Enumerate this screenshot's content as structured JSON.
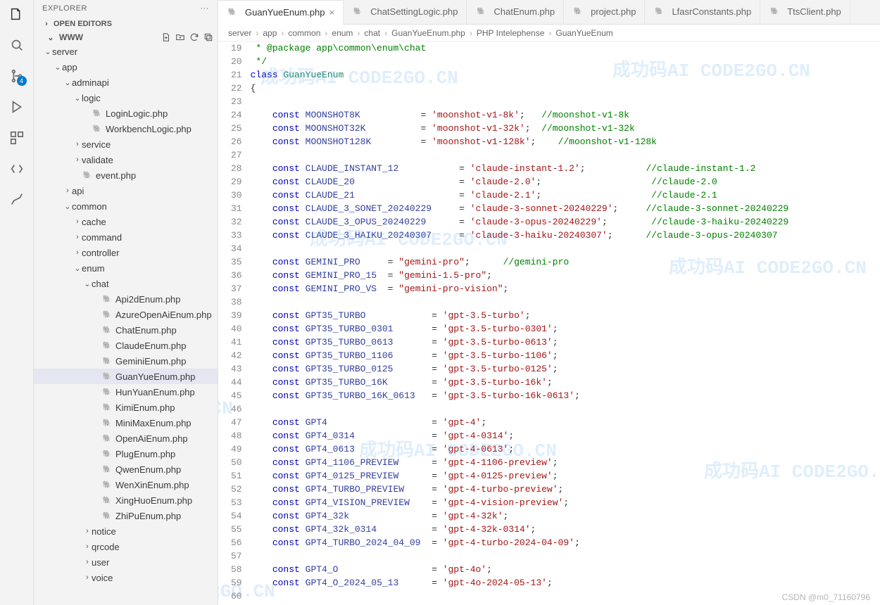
{
  "activity_badge": "4",
  "explorer": {
    "title": "EXPLORER",
    "open_editors": "OPEN EDITORS",
    "root": "WWW"
  },
  "tree": {
    "server": "server",
    "app": "app",
    "adminapi": "adminapi",
    "logic": "logic",
    "login_logic": "LoginLogic.php",
    "workbench_logic": "WorkbenchLogic.php",
    "service": "service",
    "validate": "validate",
    "event_php": "event.php",
    "api": "api",
    "common": "common",
    "cache": "cache",
    "command": "command",
    "controller": "controller",
    "enum": "enum",
    "chat": "chat",
    "api2d": "Api2dEnum.php",
    "azure": "AzureOpenAiEnum.php",
    "chatenum": "ChatEnum.php",
    "claude": "ClaudeEnum.php",
    "gemini": "GeminiEnum.php",
    "guanyue": "GuanYueEnum.php",
    "hunyuan": "HunYuanEnum.php",
    "kimi": "KimiEnum.php",
    "minimax": "MiniMaxEnum.php",
    "openai": "OpenAiEnum.php",
    "plug": "PlugEnum.php",
    "qwen": "QwenEnum.php",
    "wenxin": "WenXinEnum.php",
    "xinghuo": "XingHuoEnum.php",
    "zhipu": "ZhiPuEnum.php",
    "notice": "notice",
    "qrcode": "qrcode",
    "user": "user",
    "voice": "voice"
  },
  "tabs": [
    {
      "label": "GuanYueEnum.php",
      "active": true,
      "close": true
    },
    {
      "label": "ChatSettingLogic.php"
    },
    {
      "label": "ChatEnum.php"
    },
    {
      "label": "project.php"
    },
    {
      "label": "LfasrConstants.php"
    },
    {
      "label": "TtsClient.php"
    }
  ],
  "breadcrumbs": [
    "server",
    "app",
    "common",
    "enum",
    "chat",
    "GuanYueEnum.php",
    "PHP Intelephense",
    "GuanYueEnum"
  ],
  "bc_sep": "›",
  "code": {
    "first_line": 19,
    "lines": [
      {
        "t": "com",
        "s": " * @package app\\common\\enum\\chat"
      },
      {
        "t": "com",
        "s": " */"
      },
      {
        "t": "classdecl",
        "kw": "class",
        "name": "GuanYueEnum"
      },
      {
        "t": "punc",
        "s": "{"
      },
      {
        "t": "blank"
      },
      {
        "t": "const",
        "n": "MOONSHOT8K",
        "v": "'moonshot-v1-8k'",
        "c": "//moonshot-v1-8k",
        "p1": 11,
        "p2": 3
      },
      {
        "t": "const",
        "n": "MOONSHOT32K",
        "v": "'moonshot-v1-32k'",
        "c": "//moonshot-v1-32k",
        "p1": 10,
        "p2": 2
      },
      {
        "t": "const",
        "n": "MOONSHOT128K",
        "v": "'moonshot-v1-128k'",
        "c": "//moonshot-v1-128k",
        "p1": 9,
        "p2": 4
      },
      {
        "t": "blank"
      },
      {
        "t": "const",
        "n": "CLAUDE_INSTANT_12",
        "v": "'claude-instant-1.2'",
        "c": "//claude-instant-1.2",
        "p1": 11,
        "p2": 11
      },
      {
        "t": "const",
        "n": "CLAUDE_20",
        "v": "'claude-2.0'",
        "c": "//claude-2.0",
        "p1": 19,
        "p2": 20
      },
      {
        "t": "const",
        "n": "CLAUDE_21",
        "v": "'claude-2.1'",
        "c": "//claude-2.1",
        "p1": 19,
        "p2": 20
      },
      {
        "t": "const",
        "n": "CLAUDE_3_SONET_20240229",
        "v": "'claude-3-sonnet-20240229'",
        "c": "//claude-3-sonnet-20240229",
        "p1": 5,
        "p2": 5
      },
      {
        "t": "const",
        "n": "CLAUDE_3_OPUS_20240229",
        "v": "'claude-3-opus-20240229'",
        "c": "//claude-3-haiku-20240229",
        "p1": 6,
        "p2": 8
      },
      {
        "t": "const",
        "n": "CLAUDE_3_HAIKU_20240307",
        "v": "'claude-3-haiku-20240307'",
        "c": "//claude-3-opus-20240307",
        "p1": 5,
        "p2": 6
      },
      {
        "t": "blank"
      },
      {
        "t": "const",
        "n": "GEMINI_PRO",
        "v": "\"gemini-pro\"",
        "c": "//gemini-pro",
        "p1": 5,
        "p2": 6
      },
      {
        "t": "const",
        "n": "GEMINI_PRO_15",
        "v": "\"gemini-1.5-pro\"",
        "p1": 2
      },
      {
        "t": "const",
        "n": "GEMINI_PRO_VS",
        "v": "\"gemini-pro-vision\"",
        "p1": 2
      },
      {
        "t": "blank"
      },
      {
        "t": "const",
        "n": "GPT35_TURBO",
        "v": "'gpt-3.5-turbo'",
        "p1": 12
      },
      {
        "t": "const",
        "n": "GPT35_TURBO_0301",
        "v": "'gpt-3.5-turbo-0301'",
        "p1": 7
      },
      {
        "t": "const",
        "n": "GPT35_TURBO_0613",
        "v": "'gpt-3.5-turbo-0613'",
        "p1": 7
      },
      {
        "t": "const",
        "n": "GPT35_TURBO_1106",
        "v": "'gpt-3.5-turbo-1106'",
        "p1": 7
      },
      {
        "t": "const",
        "n": "GPT35_TURBO_0125",
        "v": "'gpt-3.5-turbo-0125'",
        "p1": 7
      },
      {
        "t": "const",
        "n": "GPT35_TURBO_16K",
        "v": "'gpt-3.5-turbo-16k'",
        "p1": 8
      },
      {
        "t": "const",
        "n": "GPT35_TURBO_16K_0613",
        "v": "'gpt-3.5-turbo-16k-0613'",
        "p1": 3
      },
      {
        "t": "blank"
      },
      {
        "t": "const",
        "n": "GPT4",
        "v": "'gpt-4'",
        "p1": 19
      },
      {
        "t": "const",
        "n": "GPT4_0314",
        "v": "'gpt-4-0314'",
        "p1": 14
      },
      {
        "t": "const",
        "n": "GPT4_0613",
        "v": "'gpt-4-0613'",
        "p1": 14
      },
      {
        "t": "const",
        "n": "GPT4_1106_PREVIEW",
        "v": "'gpt-4-1106-preview'",
        "p1": 6
      },
      {
        "t": "const",
        "n": "GPT4_0125_PREVIEW",
        "v": "'gpt-4-0125-preview'",
        "p1": 6
      },
      {
        "t": "const",
        "n": "GPT4_TURBO_PREVIEW",
        "v": "'gpt-4-turbo-preview'",
        "p1": 5
      },
      {
        "t": "const",
        "n": "GPT4_VISION_PREVIEW",
        "v": "'gpt-4-vision-preview'",
        "p1": 4
      },
      {
        "t": "const",
        "n": "GPT4_32k",
        "v": "'gpt-4-32k'",
        "p1": 15
      },
      {
        "t": "const",
        "n": "GPT4_32k_0314",
        "v": "'gpt-4-32k-0314'",
        "p1": 10
      },
      {
        "t": "const",
        "n": "GPT4_TURBO_2024_04_09",
        "v": "'gpt-4-turbo-2024-04-09'",
        "p1": 2
      },
      {
        "t": "blank"
      },
      {
        "t": "const",
        "n": "GPT4_O",
        "v": "'gpt-4o'",
        "p1": 17
      },
      {
        "t": "const",
        "n": "GPT4_O_2024_05_13",
        "v": "'gpt-4o-2024-05-13'",
        "p1": 6
      },
      {
        "t": "blank"
      }
    ]
  },
  "watermark_text": "成功码AI  CODE2GO.CN",
  "footer_credit": "CSDN @m0_71160796"
}
